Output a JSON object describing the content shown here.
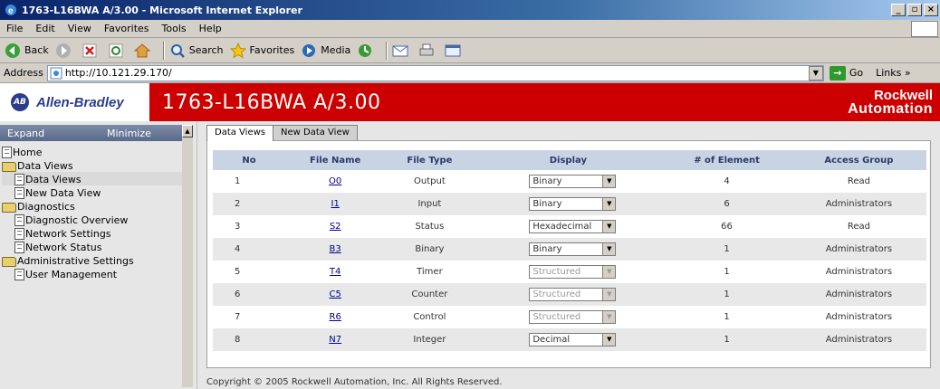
{
  "window": {
    "title": "1763-L16BWA A/3.00 - Microsoft Internet Explorer",
    "min": "_",
    "max": "▫",
    "close": "×"
  },
  "menu": [
    "File",
    "Edit",
    "View",
    "Favorites",
    "Tools",
    "Help"
  ],
  "toolbar": {
    "back": "Back",
    "search": "Search",
    "favorites": "Favorites",
    "media": "Media"
  },
  "address": {
    "label": "Address",
    "url": "http://10.121.29.170/",
    "go": "Go",
    "links": "Links »"
  },
  "header": {
    "logo_mark": "AB",
    "brand": "Allen-Bradley",
    "title": "1763-L16BWA A/3.00",
    "rockwell_line1": "Rockwell",
    "rockwell_line2": "Automation"
  },
  "sidebar": {
    "expand": "Expand",
    "minimize": "Minimize",
    "items": [
      {
        "label": "Home"
      },
      {
        "label": "Data Views"
      },
      {
        "label": "Data Views"
      },
      {
        "label": "New Data View"
      },
      {
        "label": "Diagnostics"
      },
      {
        "label": "Diagnostic Overview"
      },
      {
        "label": "Network Settings"
      },
      {
        "label": "Network Status"
      },
      {
        "label": "Administrative Settings"
      },
      {
        "label": "User Management"
      }
    ]
  },
  "tabs": [
    "Data Views",
    "New Data View"
  ],
  "table": {
    "headers": [
      "No",
      "File Name",
      "File Type",
      "Display",
      "# of Element",
      "Access Group"
    ],
    "rows": [
      {
        "no": "1",
        "file": "O0",
        "type": "Output",
        "display": "Binary",
        "elements": "4",
        "access": "Read"
      },
      {
        "no": "2",
        "file": "I1",
        "type": "Input",
        "display": "Binary",
        "elements": "6",
        "access": "Administrators"
      },
      {
        "no": "3",
        "file": "S2",
        "type": "Status",
        "display": "Hexadecimal",
        "elements": "66",
        "access": "Read"
      },
      {
        "no": "4",
        "file": "B3",
        "type": "Binary",
        "display": "Binary",
        "elements": "1",
        "access": "Administrators"
      },
      {
        "no": "5",
        "file": "T4",
        "type": "Timer",
        "display": "Structured",
        "elements": "1",
        "access": "Administrators"
      },
      {
        "no": "6",
        "file": "C5",
        "type": "Counter",
        "display": "Structured",
        "elements": "1",
        "access": "Administrators"
      },
      {
        "no": "7",
        "file": "R6",
        "type": "Control",
        "display": "Structured",
        "elements": "1",
        "access": "Administrators"
      },
      {
        "no": "8",
        "file": "N7",
        "type": "Integer",
        "display": "Decimal",
        "elements": "1",
        "access": "Administrators"
      }
    ]
  },
  "footer": "Copyright © 2005 Rockwell Automation, Inc. All Rights Reserved."
}
